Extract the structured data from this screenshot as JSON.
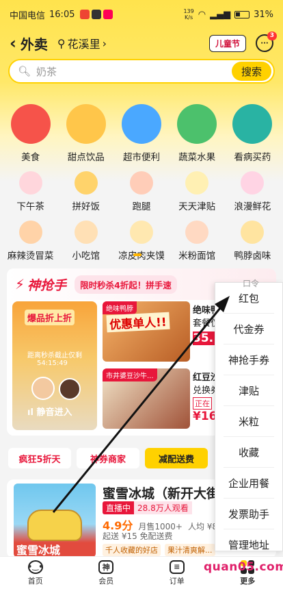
{
  "status": {
    "carrier": "中国电信",
    "time": "16:05",
    "speed_value": "139",
    "speed_unit": "K/s",
    "battery": "31%"
  },
  "nav": {
    "back": "‹",
    "title": "外卖",
    "location": "花溪里",
    "kids_badge": "儿童节",
    "msg_count": "3"
  },
  "search": {
    "placeholder": "奶茶",
    "button": "搜索"
  },
  "categories_big": [
    {
      "label": "美食",
      "icon": "food-icon",
      "color": "#f6534a"
    },
    {
      "label": "甜点饮品",
      "icon": "dessert-icon",
      "color": "#ffc64a"
    },
    {
      "label": "超市便利",
      "icon": "basket-icon",
      "color": "#4aa8ff"
    },
    {
      "label": "蔬菜水果",
      "icon": "fruit-icon",
      "color": "#4cc16c"
    },
    {
      "label": "看病买药",
      "icon": "medicine-icon",
      "color": "#29b3a3"
    }
  ],
  "categories_small_1": [
    {
      "label": "下午茶",
      "icon": "tea-cup-icon",
      "color": "#ffd6dc"
    },
    {
      "label": "拼好饭",
      "icon": "bowl-icon",
      "color": "#ffd36b"
    },
    {
      "label": "跑腿",
      "icon": "runner-icon",
      "color": "#ffcdb8"
    },
    {
      "label": "天天津贴",
      "icon": "coupon-icon",
      "color": "#fff0b3"
    },
    {
      "label": "浪漫鲜花",
      "icon": "flower-icon",
      "color": "#ffd4e4"
    }
  ],
  "categories_small_2": [
    {
      "label": "麻辣烫冒菜",
      "icon": "spicy-pot-icon",
      "color": "#ffd3a8"
    },
    {
      "label": "小吃馆",
      "icon": "drumstick-icon",
      "color": "#ffe0b5"
    },
    {
      "label": "凉皮肉夹馍",
      "icon": "sandwich-icon",
      "color": "#ffe8b0"
    },
    {
      "label": "米粉面馆",
      "icon": "noodle-icon",
      "color": "#ffd9c2"
    },
    {
      "label": "鸭脖卤味",
      "icon": "duck-icon",
      "color": "#ffe4a0"
    }
  ],
  "colors": {
    "accent": "#ffd100",
    "brand_red": "#e8173b"
  },
  "flash": {
    "logo": "神抢手",
    "promo": "限时秒杀4折起！拼手速",
    "live_caption": "爆品折上折",
    "live_sub": "距离秒杀截止仅剩",
    "live_timer": "54:15:49",
    "live_enter": "静音进入",
    "prod1_tag": "绝味鸭脖",
    "prod1_banner": "优惠单人!!",
    "prod1_name": "绝味鸭",
    "prod1_sub": "套餐仅",
    "prod1_price": "35.",
    "prod2_tag": "市井婆豆沙牛...",
    "prod2_name": "红豆沙",
    "prod2_sub": "兑换券",
    "prod2_badge": "正在",
    "prod2_price": "¥16."
  },
  "pills": [
    "疯狂5折天",
    "神券商家",
    "减配送费"
  ],
  "store": {
    "image_text": "蜜雪冰城",
    "name": "蜜雪冰城（新开大街",
    "live_a": "直播中",
    "live_b": "28.8万人观看",
    "score": "4.9分",
    "sold": "月售1000+",
    "avg": "人均 ¥8",
    "delivery": "起送 ¥15  免配送费",
    "tags": [
      "千人收藏的好店",
      "果汁清爽解..."
    ]
  },
  "tabs": [
    "首页",
    "会员",
    "订单",
    "更多"
  ],
  "menu": {
    "peek": "口令",
    "items": [
      "红包",
      "代金券",
      "神抢手券",
      "津贴",
      "米粒",
      "收藏",
      "企业用餐",
      "发票助手",
      "管理地址"
    ]
  },
  "watermark": "quan05.com"
}
